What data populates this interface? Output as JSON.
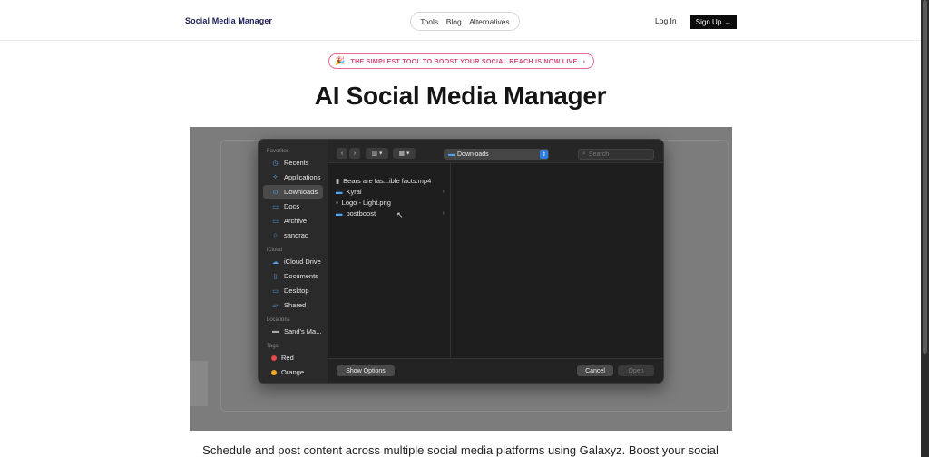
{
  "header": {
    "brand": "Social Media Manager",
    "nav": [
      "Tools",
      "Blog",
      "Alternatives"
    ],
    "login": "Log In",
    "signup": "Sign Up",
    "signup_icon": "arrow-right-icon"
  },
  "announcement": {
    "emoji": "🎉",
    "text": "THE SIMPLEST TOOL TO BOOST YOUR SOCIAL REACH IS NOW LIVE",
    "chevron": "›"
  },
  "hero": {
    "title": "AI Social Media Manager",
    "description": "Schedule and post content across multiple social media platforms using Galaxyz. Boost your social"
  },
  "dialog": {
    "sidebar": {
      "favorites_label": "Favorites",
      "favorites": [
        {
          "label": "Recents",
          "icon": "clock-icon"
        },
        {
          "label": "Applications",
          "icon": "apps-icon"
        },
        {
          "label": "Downloads",
          "icon": "download-icon",
          "active": true
        },
        {
          "label": "Docs",
          "icon": "folder-icon"
        },
        {
          "label": "Archive",
          "icon": "folder-icon"
        },
        {
          "label": "sandrao",
          "icon": "home-icon"
        }
      ],
      "icloud_label": "iCloud",
      "icloud": [
        {
          "label": "iCloud Drive",
          "icon": "cloud-icon"
        },
        {
          "label": "Documents",
          "icon": "document-icon"
        },
        {
          "label": "Desktop",
          "icon": "desktop-icon"
        },
        {
          "label": "Shared",
          "icon": "shared-folder-icon"
        }
      ],
      "locations_label": "Locations",
      "locations": [
        {
          "label": "Sand's Ma...",
          "icon": "laptop-icon"
        }
      ],
      "tags_label": "Tags",
      "tags": [
        {
          "label": "Red",
          "color": "#e5484d"
        },
        {
          "label": "Orange",
          "color": "#f5a623"
        }
      ]
    },
    "toolbar": {
      "location": "Downloads",
      "search_placeholder": "Search"
    },
    "files": [
      {
        "name": "Bears are fas...ible facts.mp4",
        "icon": "video-file-icon",
        "folder": false
      },
      {
        "name": "Kyral",
        "icon": "folder-icon",
        "folder": true
      },
      {
        "name": "Logo - Light.png",
        "icon": "image-file-icon",
        "folder": false
      },
      {
        "name": "postboost",
        "icon": "folder-icon",
        "folder": true
      }
    ],
    "buttons": {
      "show_options": "Show Options",
      "cancel": "Cancel",
      "open": "Open"
    }
  },
  "colors": {
    "accent_pink": "#d24a78",
    "folder_blue": "#4aa3f0",
    "select_blue": "#2f7de1"
  }
}
